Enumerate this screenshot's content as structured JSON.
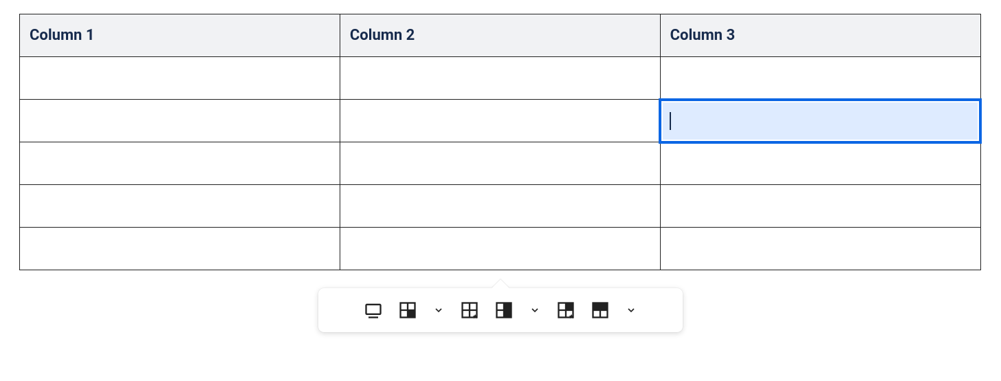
{
  "table": {
    "headers": [
      "Column 1",
      "Column 2",
      "Column 3"
    ],
    "rows": 5,
    "selected": {
      "row": 1,
      "col": 2
    }
  },
  "toolbar": {
    "icons": [
      "table-width",
      "table-cell-options",
      "table-row-options",
      "table-column-options",
      "table-row-star",
      "table-column-star"
    ]
  }
}
